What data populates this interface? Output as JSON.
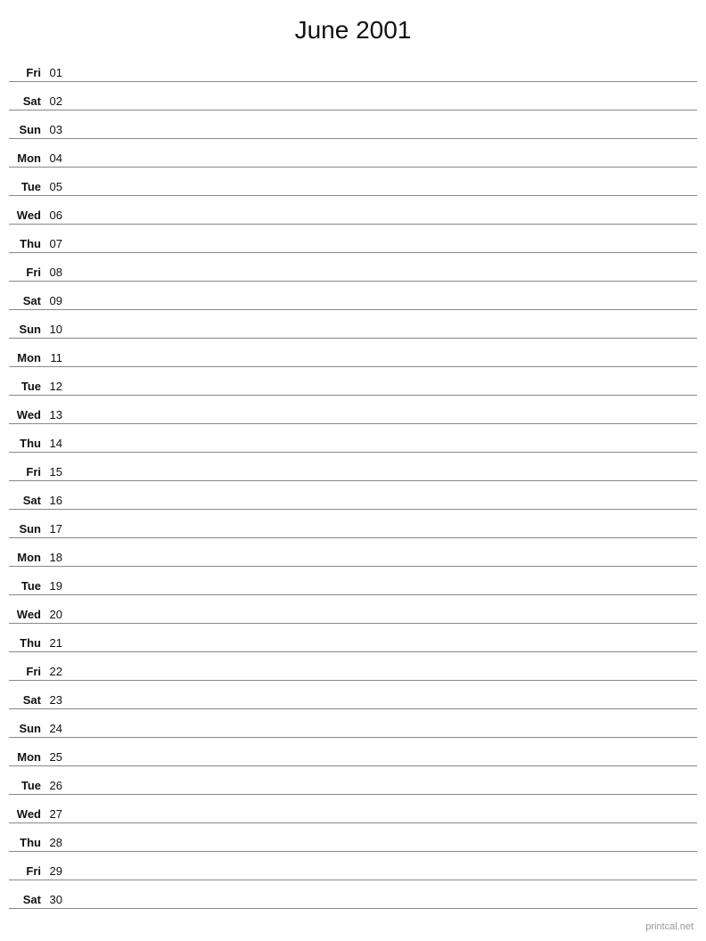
{
  "title": "June 2001",
  "footer": "printcal.net",
  "days": [
    {
      "name": "Fri",
      "num": "01"
    },
    {
      "name": "Sat",
      "num": "02"
    },
    {
      "name": "Sun",
      "num": "03"
    },
    {
      "name": "Mon",
      "num": "04"
    },
    {
      "name": "Tue",
      "num": "05"
    },
    {
      "name": "Wed",
      "num": "06"
    },
    {
      "name": "Thu",
      "num": "07"
    },
    {
      "name": "Fri",
      "num": "08"
    },
    {
      "name": "Sat",
      "num": "09"
    },
    {
      "name": "Sun",
      "num": "10"
    },
    {
      "name": "Mon",
      "num": "11"
    },
    {
      "name": "Tue",
      "num": "12"
    },
    {
      "name": "Wed",
      "num": "13"
    },
    {
      "name": "Thu",
      "num": "14"
    },
    {
      "name": "Fri",
      "num": "15"
    },
    {
      "name": "Sat",
      "num": "16"
    },
    {
      "name": "Sun",
      "num": "17"
    },
    {
      "name": "Mon",
      "num": "18"
    },
    {
      "name": "Tue",
      "num": "19"
    },
    {
      "name": "Wed",
      "num": "20"
    },
    {
      "name": "Thu",
      "num": "21"
    },
    {
      "name": "Fri",
      "num": "22"
    },
    {
      "name": "Sat",
      "num": "23"
    },
    {
      "name": "Sun",
      "num": "24"
    },
    {
      "name": "Mon",
      "num": "25"
    },
    {
      "name": "Tue",
      "num": "26"
    },
    {
      "name": "Wed",
      "num": "27"
    },
    {
      "name": "Thu",
      "num": "28"
    },
    {
      "name": "Fri",
      "num": "29"
    },
    {
      "name": "Sat",
      "num": "30"
    }
  ]
}
